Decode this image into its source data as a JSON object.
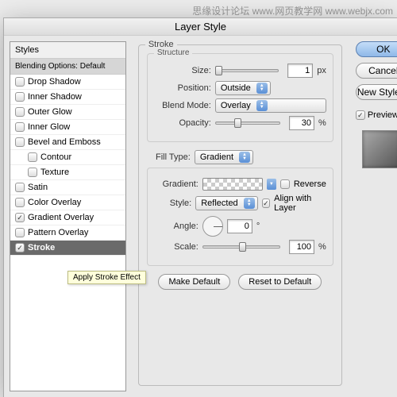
{
  "watermark": "思缘设计论坛  www.网页教学网  www.webjx.com",
  "dialog": {
    "title": "Layer Style"
  },
  "styles": {
    "header": "Styles",
    "blending": "Blending Options: Default",
    "items": [
      {
        "label": "Drop Shadow",
        "checked": false,
        "indent": false
      },
      {
        "label": "Inner Shadow",
        "checked": false,
        "indent": false
      },
      {
        "label": "Outer Glow",
        "checked": false,
        "indent": false
      },
      {
        "label": "Inner Glow",
        "checked": false,
        "indent": false
      },
      {
        "label": "Bevel and Emboss",
        "checked": false,
        "indent": false
      },
      {
        "label": "Contour",
        "checked": false,
        "indent": true
      },
      {
        "label": "Texture",
        "checked": false,
        "indent": true
      },
      {
        "label": "Satin",
        "checked": false,
        "indent": false
      },
      {
        "label": "Color Overlay",
        "checked": false,
        "indent": false
      },
      {
        "label": "Gradient Overlay",
        "checked": true,
        "indent": false
      },
      {
        "label": "Pattern Overlay",
        "checked": false,
        "indent": false
      },
      {
        "label": "Stroke",
        "checked": true,
        "indent": false,
        "selected": true
      }
    ]
  },
  "tooltip": "Apply Stroke Effect",
  "stroke": {
    "group": "Stroke",
    "structure": {
      "legend": "Structure",
      "size": {
        "label": "Size:",
        "value": "1",
        "unit": "px"
      },
      "position": {
        "label": "Position:",
        "value": "Outside"
      },
      "blend": {
        "label": "Blend Mode:",
        "value": "Overlay"
      },
      "opacity": {
        "label": "Opacity:",
        "value": "30",
        "unit": "%"
      }
    },
    "filltype": {
      "label": "Fill Type:",
      "value": "Gradient"
    },
    "gradient": {
      "label": "Gradient:",
      "reverse": {
        "label": "Reverse",
        "checked": false
      },
      "style": {
        "label": "Style:",
        "value": "Reflected"
      },
      "align": {
        "label": "Align with Layer",
        "checked": true
      },
      "angle": {
        "label": "Angle:",
        "value": "0",
        "unit": "°"
      },
      "scale": {
        "label": "Scale:",
        "value": "100",
        "unit": "%"
      }
    },
    "buttons": {
      "default": "Make Default",
      "reset": "Reset to Default"
    }
  },
  "right": {
    "ok": "OK",
    "cancel": "Cancel",
    "newstyle": "New Style…",
    "preview": "Preview"
  }
}
